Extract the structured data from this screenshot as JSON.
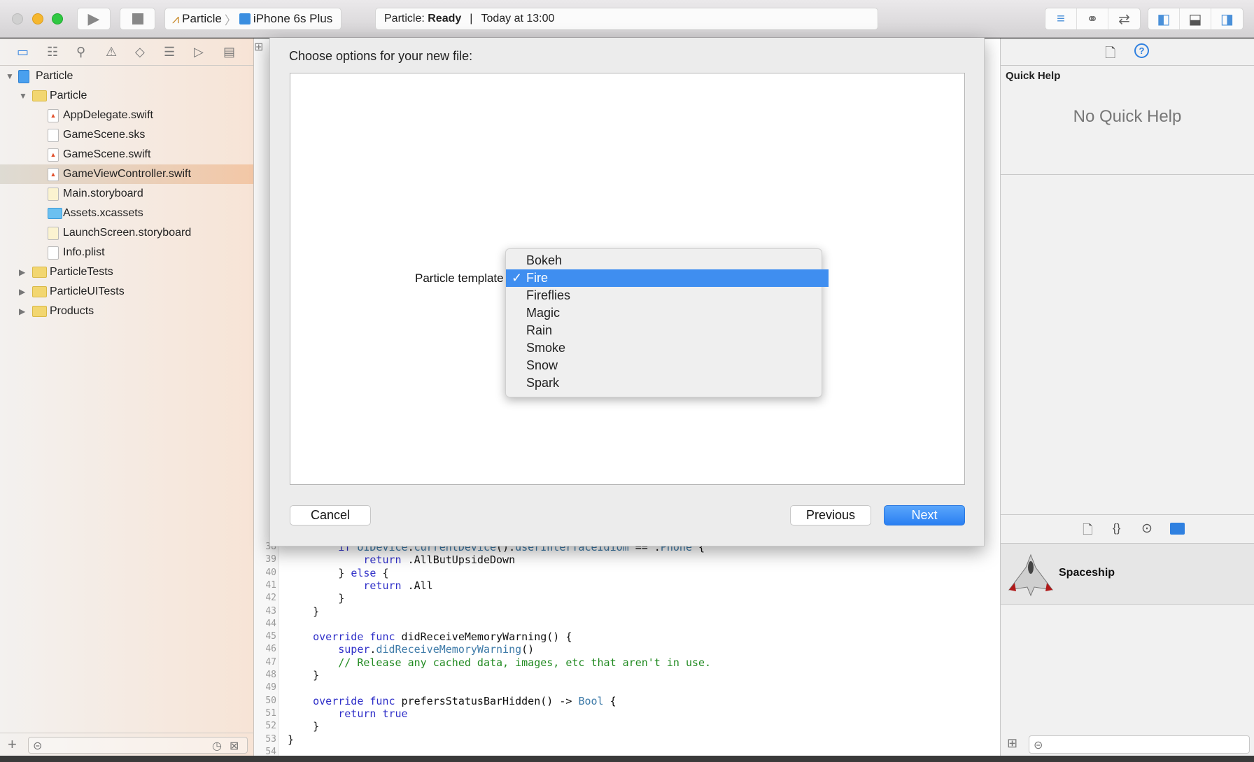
{
  "toolbar": {
    "scheme": "Particle",
    "device": "iPhone 6s Plus",
    "activity_project": "Particle: ",
    "activity_status": "Ready",
    "activity_sep": "|",
    "activity_time": "Today at 13:00",
    "colors": {
      "close": "#d0d0d0",
      "minimize": "#f5b72f",
      "zoom": "#2fc842"
    }
  },
  "navigator": {
    "tree": [
      {
        "label": "Particle",
        "level": 0,
        "kind": "project",
        "expanded": true
      },
      {
        "label": "Particle",
        "level": 1,
        "kind": "folder",
        "expanded": true
      },
      {
        "label": "AppDelegate.swift",
        "level": 2,
        "kind": "swift"
      },
      {
        "label": "GameScene.sks",
        "level": 2,
        "kind": "sks"
      },
      {
        "label": "GameScene.swift",
        "level": 2,
        "kind": "swift"
      },
      {
        "label": "GameViewController.swift",
        "level": 2,
        "kind": "swift",
        "selected": true
      },
      {
        "label": "Main.storyboard",
        "level": 2,
        "kind": "storyboard"
      },
      {
        "label": "Assets.xcassets",
        "level": 2,
        "kind": "assets"
      },
      {
        "label": "LaunchScreen.storyboard",
        "level": 2,
        "kind": "storyboard"
      },
      {
        "label": "Info.plist",
        "level": 2,
        "kind": "plist"
      },
      {
        "label": "ParticleTests",
        "level": 1,
        "kind": "folder",
        "expanded": false
      },
      {
        "label": "ParticleUITests",
        "level": 1,
        "kind": "folder",
        "expanded": false
      },
      {
        "label": "Products",
        "level": 1,
        "kind": "folder",
        "expanded": false
      }
    ]
  },
  "editor": {
    "lines": [
      {
        "n": "38",
        "t": [
          [
            "",
            "        "
          ],
          [
            "kw",
            "if "
          ],
          [
            "api",
            "UIDevice"
          ],
          [
            "pl",
            "."
          ],
          [
            "api",
            "currentDevice"
          ],
          [
            "pl",
            "()."
          ],
          [
            "api",
            "userInterfaceIdiom"
          ],
          [
            "pl",
            " == ."
          ],
          [
            "api",
            "Phone"
          ],
          [
            "pl",
            " {"
          ]
        ]
      },
      {
        "n": "39",
        "t": [
          [
            "",
            "            "
          ],
          [
            "kw",
            "return"
          ],
          [
            "pl",
            " .AllButUpsideDown"
          ]
        ]
      },
      {
        "n": "40",
        "t": [
          [
            "",
            "        "
          ],
          [
            "pl",
            "} "
          ],
          [
            "kw",
            "else"
          ],
          [
            "pl",
            " {"
          ]
        ]
      },
      {
        "n": "41",
        "t": [
          [
            "",
            "            "
          ],
          [
            "kw",
            "return"
          ],
          [
            "pl",
            " .All"
          ]
        ]
      },
      {
        "n": "42",
        "t": [
          [
            "",
            "        "
          ],
          [
            "pl",
            "}"
          ]
        ]
      },
      {
        "n": "43",
        "t": [
          [
            "",
            "    "
          ],
          [
            "pl",
            "}"
          ]
        ]
      },
      {
        "n": "44",
        "t": []
      },
      {
        "n": "45",
        "t": [
          [
            "",
            "    "
          ],
          [
            "kw",
            "override func"
          ],
          [
            "pl",
            " didReceiveMemoryWarning() {"
          ]
        ]
      },
      {
        "n": "46",
        "t": [
          [
            "",
            "        "
          ],
          [
            "kw",
            "super"
          ],
          [
            "pl",
            "."
          ],
          [
            "api",
            "didReceiveMemoryWarning"
          ],
          [
            "pl",
            "()"
          ]
        ]
      },
      {
        "n": "47",
        "t": [
          [
            "",
            "        "
          ],
          [
            "cm",
            "// Release any cached data, images, etc that aren't in use."
          ]
        ]
      },
      {
        "n": "48",
        "t": [
          [
            "",
            "    "
          ],
          [
            "pl",
            "}"
          ]
        ]
      },
      {
        "n": "49",
        "t": []
      },
      {
        "n": "50",
        "t": [
          [
            "",
            "    "
          ],
          [
            "kw",
            "override func"
          ],
          [
            "pl",
            " prefersStatusBarHidden() -> "
          ],
          [
            "api",
            "Bool"
          ],
          [
            "pl",
            " {"
          ]
        ]
      },
      {
        "n": "51",
        "t": [
          [
            "",
            "        "
          ],
          [
            "kw",
            "return true"
          ]
        ]
      },
      {
        "n": "52",
        "t": [
          [
            "",
            "    "
          ],
          [
            "pl",
            "}"
          ]
        ]
      },
      {
        "n": "53",
        "t": [
          [
            "pl",
            "}"
          ]
        ]
      },
      {
        "n": "54",
        "t": []
      }
    ]
  },
  "dialog": {
    "title": "Choose options for your new file:",
    "template_label": "Particle template",
    "options": [
      "Bokeh",
      "Fire",
      "Fireflies",
      "Magic",
      "Rain",
      "Smoke",
      "Snow",
      "Spark"
    ],
    "selected": "Fire",
    "check": "✓",
    "cancel": "Cancel",
    "previous": "Previous",
    "next": "Next"
  },
  "inspector": {
    "quick_help_title": "Quick Help",
    "no_quick_help": "No Quick Help",
    "library_item": "Spaceship"
  }
}
